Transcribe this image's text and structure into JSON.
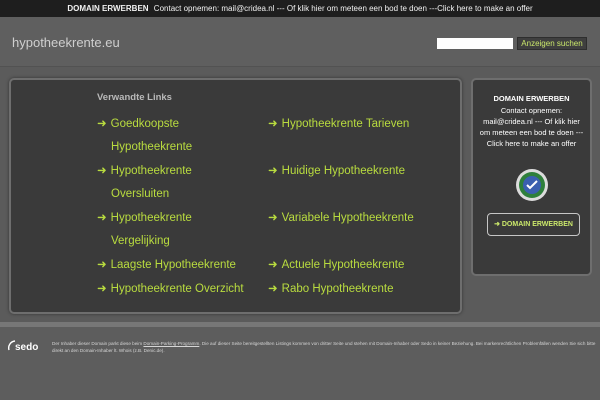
{
  "topbar": {
    "bold": "DOMAIN ERWERBEN",
    "text": "Contact opnemen: mail@cridea.nl --- Of klik hier om meteen een bod te doen ---Click here to make an offer"
  },
  "header": {
    "site_title": "hypotheekrente.eu",
    "search_value": "",
    "search_button": "Anzeigen suchen"
  },
  "links": {
    "title": "Verwandte Links",
    "items": [
      {
        "line1": "Goedkoopste",
        "line2": "Hypotheekrente"
      },
      {
        "line1": "Hypotheekrente Tarieven",
        "line2": ""
      },
      {
        "line1": "Hypotheekrente",
        "line2": "Oversluiten"
      },
      {
        "line1": "Huidige Hypotheekrente",
        "line2": ""
      },
      {
        "line1": "Hypotheekrente",
        "line2": "Vergelijking"
      },
      {
        "line1": "Variabele Hypotheekrente",
        "line2": ""
      },
      {
        "line1": "Laagste Hypotheekrente",
        "line2": ""
      },
      {
        "line1": "Actuele Hypotheekrente",
        "line2": ""
      },
      {
        "line1": "Hypotheekrente Overzicht",
        "line2": ""
      },
      {
        "line1": "Rabo Hypotheekrente",
        "line2": ""
      }
    ],
    "arrow": "➜"
  },
  "sidebar": {
    "title": "DOMAIN ERWERBEN",
    "text": "Contact opnemen: mail@cridea.nl --- Of klik hier om meteen een bod te doen ---Click here to make an offer",
    "button": "➜ DOMAIN ERWERBEN"
  },
  "footer": {
    "logo": "sedo",
    "text_before": "Der Inhaber dieser Domain parkt diese beim ",
    "text_link": "Domain-Parking-Programm",
    "text_after": ". Die auf dieser Seite bereitgestellten Listings kommen von dritter Seite und stehen mit Domain-Inhaber oder Sedo in keiner Beziehung. Bei markenrechtlichen Problemfällen wenden Sie sich bitte direkt an den Domain-Inhaber lt. Whois (z.B. Denic.de)."
  },
  "colors": {
    "accent": "#b9dc3f",
    "panel": "#3a3a3a",
    "background": "#5b5b5b"
  }
}
